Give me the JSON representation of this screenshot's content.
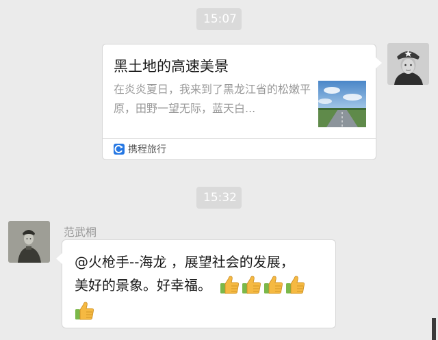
{
  "timestamps": [
    "15:07",
    "15:32"
  ],
  "link_card": {
    "title": "黑土地的高速美景",
    "description": "在炎炎夏日，我来到了黑龙江省的松嫩平原，田野一望无际，蓝天白...",
    "source": "携程旅行",
    "source_icon": "ctrip-icon",
    "thumbnail": "highway-landscape-image"
  },
  "message": {
    "sender": "范武桐",
    "line1": "@火枪手--海龙 ，展望社会的发展，",
    "line2": "美好的景象。好幸福。",
    "emoji": "thumbs-up-icon",
    "emoji_count_line2": 4,
    "emoji_count_line3": 1
  },
  "colors": {
    "background": "#ebebeb",
    "bubble": "#ffffff",
    "timestamp_pill": "#dadada",
    "thumb_yellow": "#f5b942",
    "cuff_green": "#7bb84a"
  }
}
